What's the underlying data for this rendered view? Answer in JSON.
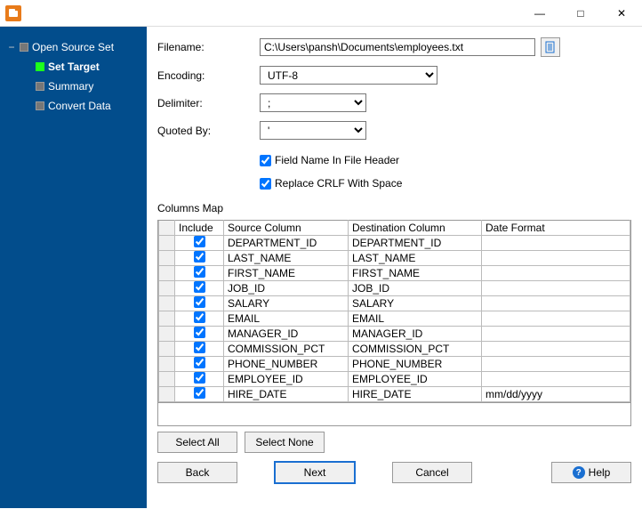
{
  "titlebar": {
    "minimize": "—",
    "maximize": "□",
    "close": "✕"
  },
  "sidebar": {
    "root": {
      "label": "Open Source Set"
    },
    "children": [
      {
        "label": "Set Target",
        "active": true,
        "bold": true
      },
      {
        "label": "Summary",
        "active": false,
        "bold": false
      },
      {
        "label": "Convert Data",
        "active": false,
        "bold": false
      }
    ]
  },
  "form": {
    "filename_label": "Filename:",
    "filename_value": "C:\\Users\\pansh\\Documents\\employees.txt",
    "encoding_label": "Encoding:",
    "encoding_value": "UTF-8",
    "delimiter_label": "Delimiter:",
    "delimiter_value": ";",
    "quoted_label": "Quoted By:",
    "quoted_value": "'",
    "field_header_label": "Field Name In File Header",
    "field_header_checked": true,
    "replace_crlf_label": "Replace CRLF With Space",
    "replace_crlf_checked": true
  },
  "columns_map_label": "Columns Map",
  "table": {
    "headers": {
      "include": "Include",
      "source": "Source Column",
      "destination": "Destination Column",
      "dateformat": "Date Format"
    },
    "rows": [
      {
        "inc": true,
        "src": "DEPARTMENT_ID",
        "dst": "DEPARTMENT_ID",
        "fmt": ""
      },
      {
        "inc": true,
        "src": "LAST_NAME",
        "dst": "LAST_NAME",
        "fmt": ""
      },
      {
        "inc": true,
        "src": "FIRST_NAME",
        "dst": "FIRST_NAME",
        "fmt": ""
      },
      {
        "inc": true,
        "src": "JOB_ID",
        "dst": "JOB_ID",
        "fmt": ""
      },
      {
        "inc": true,
        "src": "SALARY",
        "dst": "SALARY",
        "fmt": ""
      },
      {
        "inc": true,
        "src": "EMAIL",
        "dst": "EMAIL",
        "fmt": ""
      },
      {
        "inc": true,
        "src": "MANAGER_ID",
        "dst": "MANAGER_ID",
        "fmt": ""
      },
      {
        "inc": true,
        "src": "COMMISSION_PCT",
        "dst": "COMMISSION_PCT",
        "fmt": ""
      },
      {
        "inc": true,
        "src": "PHONE_NUMBER",
        "dst": "PHONE_NUMBER",
        "fmt": ""
      },
      {
        "inc": true,
        "src": "EMPLOYEE_ID",
        "dst": "EMPLOYEE_ID",
        "fmt": ""
      },
      {
        "inc": true,
        "src": "HIRE_DATE",
        "dst": "HIRE_DATE",
        "fmt": "mm/dd/yyyy"
      }
    ]
  },
  "buttons": {
    "select_all": "Select All",
    "select_none": "Select None",
    "back": "Back",
    "next": "Next",
    "cancel": "Cancel",
    "help": "Help"
  }
}
